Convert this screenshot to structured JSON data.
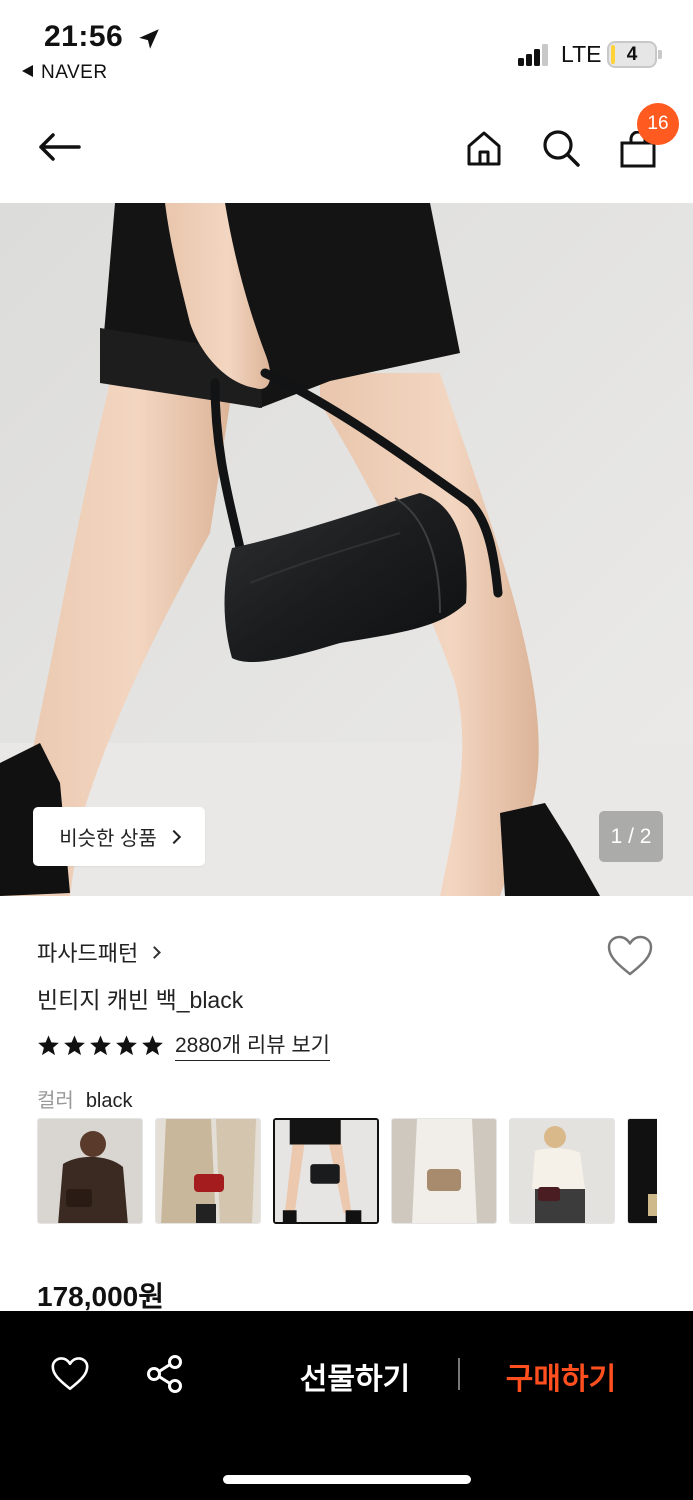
{
  "status_bar": {
    "time": "21:56",
    "back_app": "NAVER",
    "network": "LTE",
    "battery": "4"
  },
  "nav": {
    "cart_count": "16",
    "icons": [
      "back-arrow-icon",
      "home-icon",
      "search-icon",
      "shopping-bag-icon"
    ]
  },
  "hero": {
    "similar_label": "비슷한 상품",
    "counter": "1 / 2"
  },
  "product": {
    "brand": "파사드패턴",
    "name": "빈티지 캐빈 백_black",
    "rating_stars": 5,
    "review_link": "2880개 리뷰 보기",
    "color_label": "컬러",
    "color_value": "black",
    "price": "178,000원",
    "color_options": [
      {
        "selected": false
      },
      {
        "selected": false
      },
      {
        "selected": true
      },
      {
        "selected": false
      },
      {
        "selected": false
      },
      {
        "selected": false
      }
    ]
  },
  "bottom_bar": {
    "gift_label": "선물하기",
    "buy_label": "구매하기",
    "icons": [
      "heart-icon",
      "share-icon"
    ]
  },
  "colors": {
    "accent": "#ff4f1f",
    "badge": "#ff5a1f",
    "bottom_bar_bg": "#000000"
  }
}
